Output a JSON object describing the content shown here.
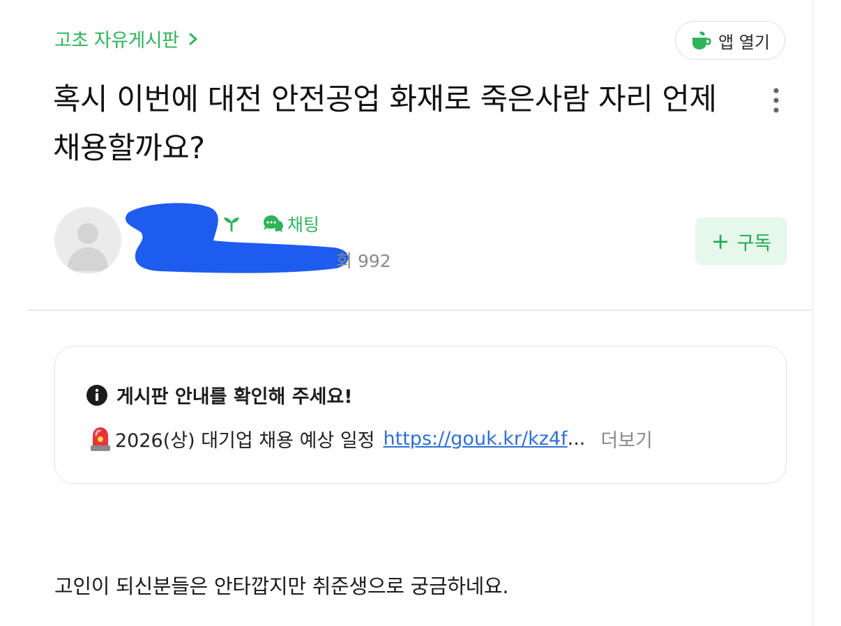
{
  "breadcrumb": {
    "label": "고초 자유게시판",
    "icon": "chevron-right-icon"
  },
  "open_app": {
    "label": "앱 열기",
    "icon": "coffee-cup-icon",
    "accent": "#2fb35a"
  },
  "post": {
    "title": "혹시 이번에 대전 안전공업 화재로 죽은사람 자리 언제 채용할까요?",
    "body": "고인이 되신분들은 안타깝지만 취준생으로 궁금하네요."
  },
  "author": {
    "avatar_icon": "default-avatar-icon",
    "name_redacted_color": "#1e5cf0",
    "level_icon": "sprout-icon",
    "chat_label": "채팅",
    "chat_icon": "chat-bubble-icon",
    "views_label": "회 992"
  },
  "subscribe": {
    "plus": "+",
    "label": "구독"
  },
  "notice": {
    "heading": "게시판 안내를 확인해 주세요!",
    "heading_icon": "info-icon",
    "line_icon": "siren-icon",
    "line_text": "2026(상) 대기업 채용 예상 일정",
    "link_text": "https://gouk.kr/kz4f",
    "ellipsis": "...",
    "more_label": "더보기"
  },
  "colors": {
    "brand_green": "#2fb35a",
    "link_blue": "#2f6fd6",
    "subscribe_bg": "#e6f7ec"
  }
}
